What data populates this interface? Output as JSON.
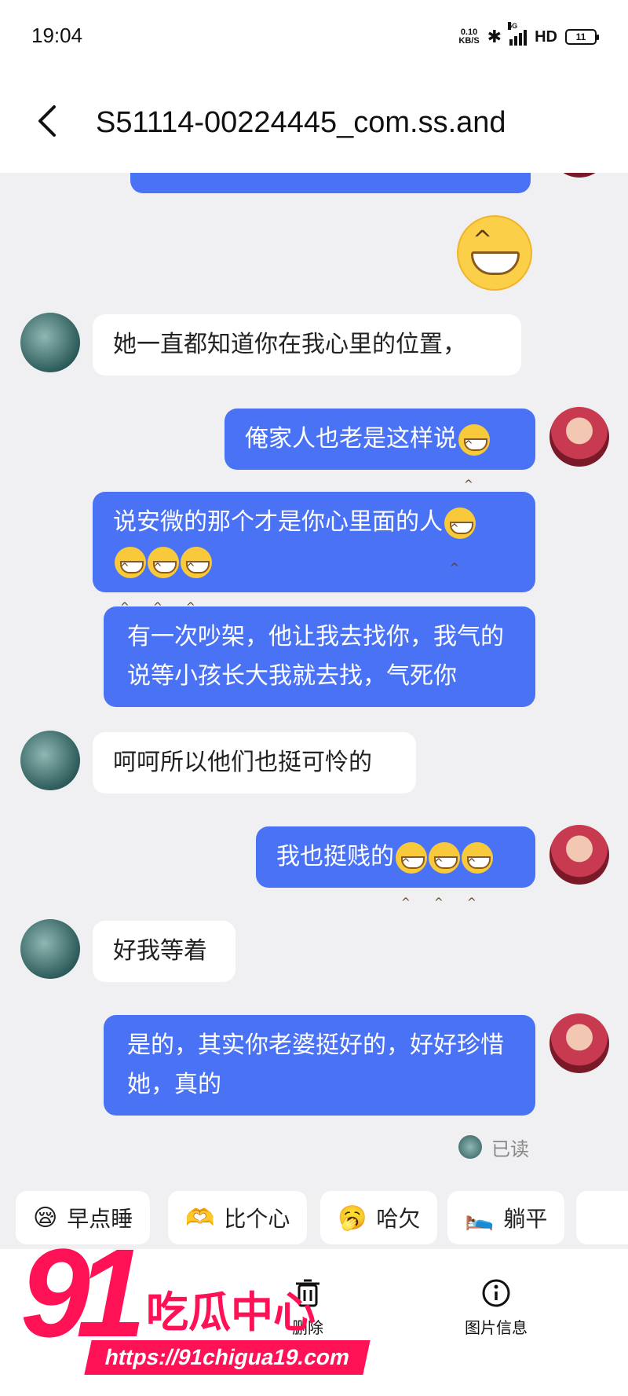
{
  "status_bar": {
    "time": "19:04",
    "net_speed_value": "0.10",
    "net_speed_unit": "KB/S",
    "signal_label": "5G",
    "hd": "HD",
    "battery": "11"
  },
  "header": {
    "title": "S51114-00224445_com.ss.and"
  },
  "messages": [
    {
      "side": "in",
      "text": "她一直都知道你在我心里的位置，",
      "emojis": 0
    },
    {
      "side": "out",
      "text": "俺家人也老是这样说",
      "emojis": 1
    },
    {
      "side": "out",
      "text": "说安微的那个才是你心里面的人",
      "emojis": 1,
      "trailing_emojis": 3
    },
    {
      "side": "out",
      "text": "有一次吵架，他让我去找你，我气的说等小孩长大我就去找，气死你",
      "emojis": 0
    },
    {
      "side": "in",
      "text": "呵呵所以他们也挺可怜的",
      "emojis": 0
    },
    {
      "side": "out",
      "text": "我也挺贱的",
      "emojis": 3
    },
    {
      "side": "in",
      "text": "好我等着",
      "emojis": 0
    },
    {
      "side": "out",
      "text": "是的，其实你老婆挺好的，好好珍惜她，真的",
      "emojis": 0
    }
  ],
  "read_status": "已读",
  "quick_replies": [
    {
      "label": "早点睡",
      "icon": "sleep-icon",
      "glyph": "😪"
    },
    {
      "label": "比个心",
      "icon": "heart-hand-icon",
      "glyph": "🫶"
    },
    {
      "label": "哈欠",
      "icon": "yawn-icon",
      "glyph": "🥱"
    },
    {
      "label": "躺平",
      "icon": "lie-flat-icon",
      "glyph": "🛌"
    }
  ],
  "bottom_bar": {
    "delete_label": "删除",
    "image_info_label": "图片信息"
  },
  "watermark": {
    "number": "91",
    "name": "吃瓜中心",
    "url": "https://91chigua19.com"
  },
  "colors": {
    "outgoing_bubble": "#4a72f5",
    "incoming_bubble": "#ffffff",
    "chat_background": "#f0f0f2",
    "watermark": "#ff1155"
  }
}
